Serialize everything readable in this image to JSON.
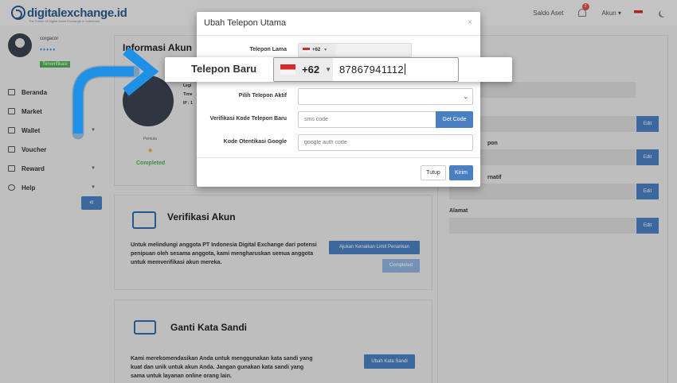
{
  "brand": {
    "logo_text": "digitalexchange.id",
    "tagline": "The Future of Digital Asset Exchange in Indonesia"
  },
  "topbar": {
    "saldo_label": "Saldo Aset",
    "notif_count": "2",
    "akun_label": "Akun ▾"
  },
  "user": {
    "name": "corgacor",
    "status_badge": "Terverifikasi"
  },
  "sidebar": {
    "items": [
      {
        "label": "Beranda",
        "icon": "monitor-icon",
        "has_caret": false
      },
      {
        "label": "Market",
        "icon": "bar-chart-icon",
        "has_caret": false
      },
      {
        "label": "Wallet",
        "icon": "wallet-icon",
        "has_caret": true
      },
      {
        "label": "Voucher",
        "icon": "voucher-icon",
        "has_caret": false
      },
      {
        "label": "Reward",
        "icon": "gift-icon",
        "has_caret": true
      },
      {
        "label": "Help",
        "icon": "headset-icon",
        "has_caret": true
      }
    ],
    "collapse_glyph": "«"
  },
  "info_card": {
    "title": "Informasi Akun",
    "lines": [
      "Legi",
      "Time",
      "IP : 1"
    ],
    "level_label": "Pemula",
    "level_status": "Completed"
  },
  "verif_card": {
    "title": "Verifikasi Akun",
    "text": "Untuk melindungi anggota PT Indonesia Digital Exchange dari potensi penipuan oleh sesama anggota, kami mengharuskan semua anggota untuk memverifikasi akun mereka.",
    "button_limit": "Ajukan Kenaikan Limit Penarikan",
    "button_completed": "Completed"
  },
  "password_card": {
    "title": "Ganti Kata Sandi",
    "text": "Kami merekomendasikan Anda untuk menggunakan kata sandi yang kuat dan unik untuk akun Anda. Jangan gunakan kata sandi yang sama untuk layanan online orang lain.",
    "button": "Ubah Kata Sandi"
  },
  "right_card": {
    "labels": [
      "pon",
      "rnatif",
      "Alamat"
    ],
    "edit_label": "Edit"
  },
  "modal": {
    "title": "Ubah Telepon Utama",
    "close_glyph": "×",
    "label_old_phone": "Telepon Lama",
    "old_country_code": "+62",
    "label_active_phone": "Pilih Telepon Aktif",
    "label_sms_code": "Verifikasi Kode Telepon Baru",
    "sms_placeholder": "sms code",
    "get_code_button": "Get Code",
    "label_google": "Kode Otentikasi Google",
    "google_placeholder": "google auth code",
    "cancel_button": "Tutup",
    "submit_button": "Kirim"
  },
  "zoom": {
    "label": "Telepon Baru",
    "country_code": "+62",
    "phone_value": "87867941112"
  },
  "colors": {
    "accent": "#4a7fc1",
    "success": "#4caf50",
    "arrow": "#1e90e6"
  }
}
